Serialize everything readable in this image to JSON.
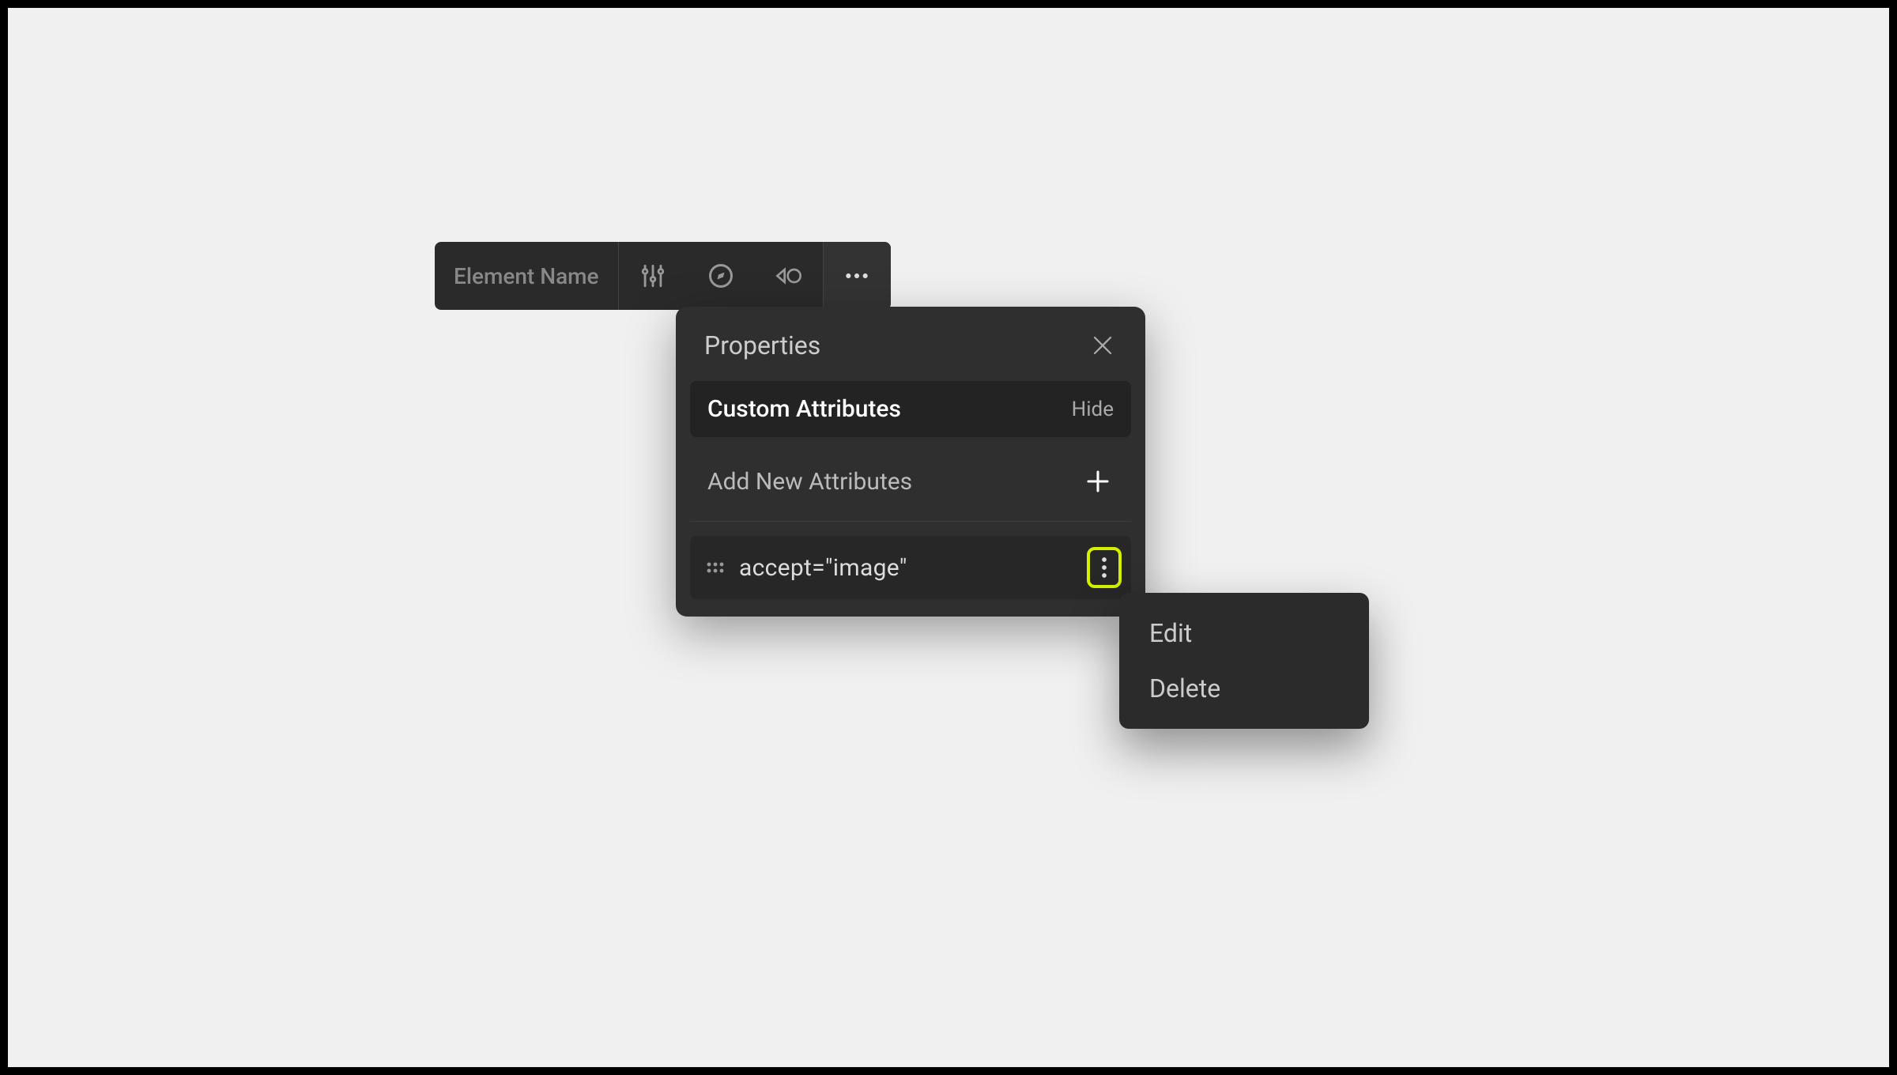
{
  "toolbar": {
    "element_label": "Element Name"
  },
  "panel": {
    "title": "Properties",
    "custom_attributes_title": "Custom Attributes",
    "hide_label": "Hide",
    "add_new_label": "Add New Attributes",
    "attribute_text": "accept=\"image\""
  },
  "context_menu": {
    "edit_label": "Edit",
    "delete_label": "Delete"
  }
}
